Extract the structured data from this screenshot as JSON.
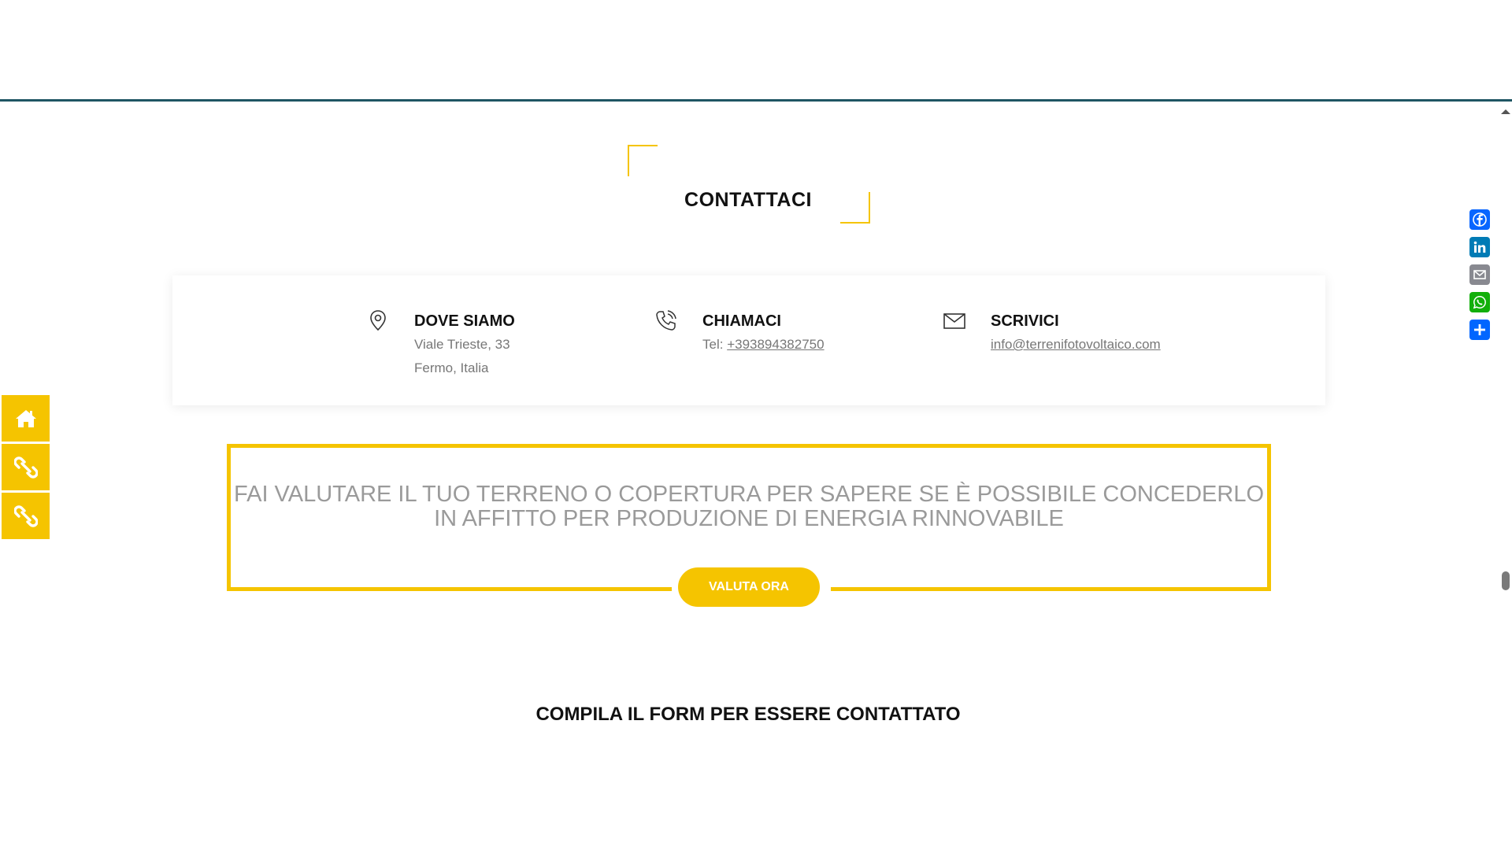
{
  "section": {
    "title": "CONTATTACI"
  },
  "contacts": [
    {
      "title": "DOVE SIAMO",
      "lines": [
        "Viale Trieste, 33",
        "Fermo, Italia"
      ],
      "icon": "location-pin-icon"
    },
    {
      "title": "CHIAMACI",
      "tel_label": "Tel: ",
      "phone": "+393894382750",
      "icon": "phone-icon"
    },
    {
      "title": "SCRIVICI",
      "email": "info@terrenifotovoltaico.com",
      "icon": "envelope-icon"
    }
  ],
  "cta": {
    "line1": "FAI VALUTARE IL TUO TERRENO O COPERTURA PER SAPERE SE È POSSIBILE CONCEDERLO",
    "line2": "IN AFFITTO PER PRODUZIONE DI ENERGIA RINNOVABILE",
    "button_label": "VALUTA ORA"
  },
  "form": {
    "title": "COMPILA IL FORM PER ESSERE CONTATTATO"
  },
  "left_rail": [
    "home-icon",
    "link-icon",
    "link-icon"
  ],
  "share": [
    {
      "icon": "facebook-icon",
      "color": "#0866ff"
    },
    {
      "icon": "linkedin-icon",
      "color": "#007bb5"
    },
    {
      "icon": "email-icon",
      "color": "#888990"
    },
    {
      "icon": "whatsapp-icon",
      "color": "#12af0a"
    },
    {
      "icon": "share-plus-icon",
      "color": "#0166ff"
    }
  ],
  "colors": {
    "accent": "#f5c400",
    "header_border": "#1e5563",
    "muted_text": "#9a9a9a"
  }
}
